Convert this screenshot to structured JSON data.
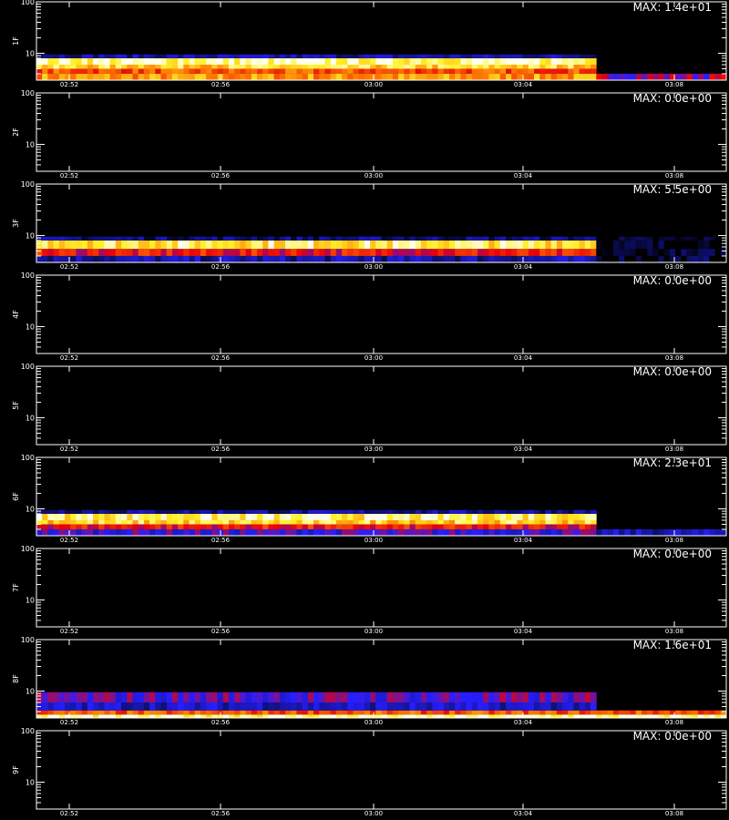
{
  "footer_text": "",
  "chart_data": [
    {
      "type": "heatmap",
      "panel_label": "1F",
      "max_text": "MAX: 1.4e+01",
      "x_ticks": [
        "02:52",
        "02:56",
        "03:00",
        "03:04",
        "03:08"
      ],
      "y_ticks": [
        10,
        100
      ],
      "y_scale": "log",
      "ylim": [
        3,
        100
      ],
      "bands": [
        {
          "y0": 3,
          "y1": 4,
          "intensity": 0.75,
          "cut_intensity": 0.45
        },
        {
          "y0": 4,
          "y1": 5,
          "intensity": 0.65,
          "cut_intensity": 0.0
        },
        {
          "y0": 5,
          "y1": 6,
          "intensity": 0.85,
          "cut_intensity": 0.0
        },
        {
          "y0": 6,
          "y1": 8,
          "intensity": 0.95,
          "cut_intensity": 0.0
        },
        {
          "y0": 8,
          "y1": 9.5,
          "intensity": 0.2,
          "cut_intensity": 0.0
        }
      ]
    },
    {
      "type": "heatmap",
      "panel_label": "2F",
      "max_text": "MAX: 0.0e+00",
      "x_ticks": [
        "02:52",
        "02:56",
        "03:00",
        "03:04",
        "03:08"
      ],
      "y_ticks": [
        10,
        100
      ],
      "y_scale": "log",
      "ylim": [
        3,
        100
      ],
      "bands": []
    },
    {
      "type": "heatmap",
      "panel_label": "3F",
      "max_text": "MAX: 5.5e+00",
      "x_ticks": [
        "02:52",
        "02:56",
        "03:00",
        "03:04",
        "03:08"
      ],
      "y_ticks": [
        10,
        100
      ],
      "y_scale": "log",
      "ylim": [
        3,
        100
      ],
      "bands": [
        {
          "y0": 3,
          "y1": 4,
          "intensity": 0.2,
          "cut_intensity": 0.05
        },
        {
          "y0": 4,
          "y1": 5.5,
          "intensity": 0.55,
          "cut_intensity": 0.03
        },
        {
          "y0": 5.5,
          "y1": 8,
          "intensity": 0.9,
          "cut_intensity": 0.03
        },
        {
          "y0": 8,
          "y1": 9.5,
          "intensity": 0.15,
          "cut_intensity": 0.02
        }
      ]
    },
    {
      "type": "heatmap",
      "panel_label": "4F",
      "max_text": "MAX: 0.0e+00",
      "x_ticks": [
        "02:52",
        "02:56",
        "03:00",
        "03:04",
        "03:08"
      ],
      "y_ticks": [
        10,
        100
      ],
      "y_scale": "log",
      "ylim": [
        3,
        100
      ],
      "bands": []
    },
    {
      "type": "heatmap",
      "panel_label": "5F",
      "max_text": "MAX: 0.0e+00",
      "x_ticks": [
        "02:52",
        "02:56",
        "03:00",
        "03:04",
        "03:08"
      ],
      "y_ticks": [
        10,
        100
      ],
      "y_scale": "log",
      "ylim": [
        3,
        100
      ],
      "bands": []
    },
    {
      "type": "heatmap",
      "panel_label": "6F",
      "max_text": "MAX: 2.3e+01",
      "x_ticks": [
        "02:52",
        "02:56",
        "03:00",
        "03:04",
        "03:08"
      ],
      "y_ticks": [
        10,
        100
      ],
      "y_scale": "log",
      "ylim": [
        3,
        100
      ],
      "bands": [
        {
          "y0": 3,
          "y1": 4,
          "intensity": 0.35,
          "cut_intensity": 0.22
        },
        {
          "y0": 4,
          "y1": 5,
          "intensity": 0.55,
          "cut_intensity": 0.0
        },
        {
          "y0": 5,
          "y1": 6,
          "intensity": 0.85,
          "cut_intensity": 0.0
        },
        {
          "y0": 6,
          "y1": 8,
          "intensity": 0.92,
          "cut_intensity": 0.0
        },
        {
          "y0": 8,
          "y1": 9.5,
          "intensity": 0.18,
          "cut_intensity": 0.0
        }
      ]
    },
    {
      "type": "heatmap",
      "panel_label": "7F",
      "max_text": "MAX: 0.0e+00",
      "x_ticks": [
        "02:52",
        "02:56",
        "03:00",
        "03:04",
        "03:08"
      ],
      "y_ticks": [
        10,
        100
      ],
      "y_scale": "log",
      "ylim": [
        3,
        100
      ],
      "bands": []
    },
    {
      "type": "heatmap",
      "panel_label": "8F",
      "max_text": "MAX: 1.6e+01",
      "x_ticks": [
        "02:52",
        "02:56",
        "03:00",
        "03:04",
        "03:08"
      ],
      "y_ticks": [
        10,
        100
      ],
      "y_scale": "log",
      "ylim": [
        3,
        100
      ],
      "bands": [
        {
          "y0": 3,
          "y1": 3.5,
          "intensity": 0.95,
          "cut_intensity": 0.95
        },
        {
          "y0": 3.5,
          "y1": 4.2,
          "intensity": 0.65,
          "cut_intensity": 0.65
        },
        {
          "y0": 4.2,
          "y1": 6,
          "intensity": 0.25,
          "cut_intensity": 0.0
        },
        {
          "y0": 6,
          "y1": 9.5,
          "intensity": 0.38,
          "cut_intensity": 0.0
        }
      ]
    },
    {
      "type": "heatmap",
      "panel_label": "9F",
      "max_text": "MAX: 0.0e+00",
      "x_ticks": [
        "02:52",
        "02:56",
        "03:00",
        "03:04",
        "03:08"
      ],
      "y_ticks": [
        10,
        100
      ],
      "y_scale": "log",
      "ylim": [
        3,
        100
      ],
      "bands": []
    }
  ]
}
